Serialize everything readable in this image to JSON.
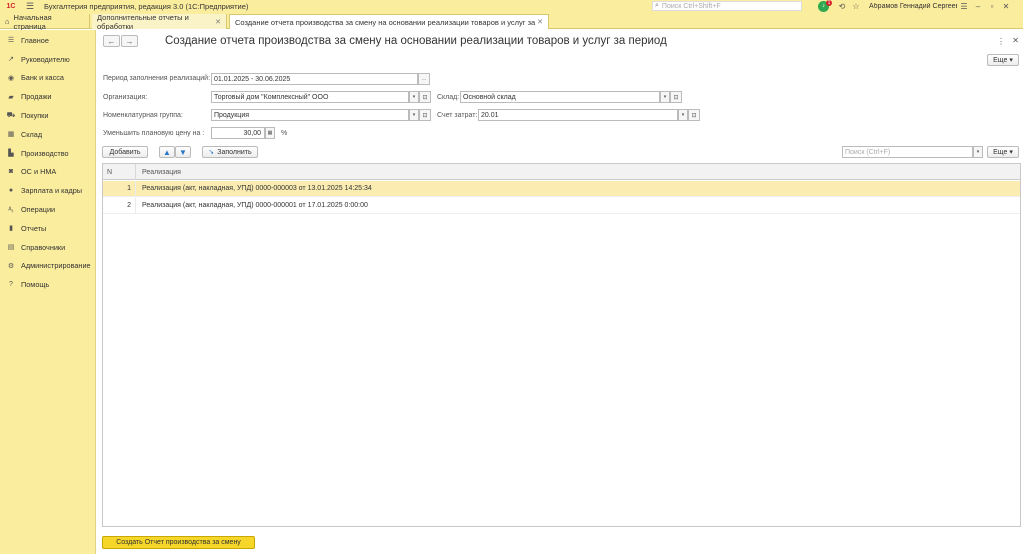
{
  "app": {
    "logo": "1С",
    "title": "Бухгалтерия предприятия, редакция 3.0  (1С:Предприятие)",
    "search_placeholder": "Поиск Ctrl+Shift+F",
    "notifications_count": "1",
    "user_name": "Абрамов Геннадий Сергеевич"
  },
  "tabs": {
    "home": "Начальная страница",
    "items": [
      {
        "label": "Дополнительные отчеты и обработки"
      },
      {
        "label": "Создание отчета производства за смену на основании реализации товаров и услуг за период"
      }
    ]
  },
  "sidebar": {
    "items": [
      {
        "label": "Главное",
        "icon": "menu-icon"
      },
      {
        "label": "Руководителю",
        "icon": "trend-icon"
      },
      {
        "label": "Банк и касса",
        "icon": "coins-icon"
      },
      {
        "label": "Продажи",
        "icon": "sales-icon"
      },
      {
        "label": "Покупки",
        "icon": "cart-icon"
      },
      {
        "label": "Склад",
        "icon": "warehouse-icon"
      },
      {
        "label": "Производство",
        "icon": "factory-icon"
      },
      {
        "label": "ОС и НМА",
        "icon": "truck-icon"
      },
      {
        "label": "Зарплата и кадры",
        "icon": "person-icon"
      },
      {
        "label": "Операции",
        "icon": "operations-icon"
      },
      {
        "label": "Отчеты",
        "icon": "chart-icon"
      },
      {
        "label": "Справочники",
        "icon": "book-icon"
      },
      {
        "label": "Администрирование",
        "icon": "gear-icon"
      },
      {
        "label": "Помощь",
        "icon": "help-icon"
      }
    ]
  },
  "form": {
    "title": "Создание отчета производства за смену на основании реализации товаров и услуг за период",
    "more_label": "Еще",
    "period_label": "Период заполнения реализаций:",
    "period_value": "01.01.2025 - 30.06.2025",
    "org_label": "Организация:",
    "org_value": "Торговый дом \"Комплексный\" ООО",
    "warehouse_label": "Склад:",
    "warehouse_value": "Основной склад",
    "nomgroup_label": "Номенклатурная группа:",
    "nomgroup_value": "Продукция",
    "account_label": "Счет затрат:",
    "account_value": "20.01",
    "reduce_label": "Уменьшить плановую цену на :",
    "reduce_value": "30,00",
    "percent": "%"
  },
  "toolbar": {
    "add_label": "Добавить",
    "fill_label": "Заполнить",
    "search_placeholder": "Поиск (Ctrl+F)",
    "more_label": "Еще"
  },
  "table": {
    "columns": [
      "N",
      "Реализация"
    ],
    "rows": [
      {
        "n": "1",
        "realization": "Реализация (акт, накладная, УПД) 0000-000003 от 13.01.2025 14:25:34"
      },
      {
        "n": "2",
        "realization": "Реализация (акт, накладная, УПД) 0000-000001 от 17.01.2025 0:00:00"
      }
    ]
  },
  "footer": {
    "create_label": "Создать Отчет производства за смену"
  },
  "colors": {
    "chrome": "#fbed9e",
    "selected_row": "#fbedb2",
    "primary_button": "#f5d629"
  }
}
